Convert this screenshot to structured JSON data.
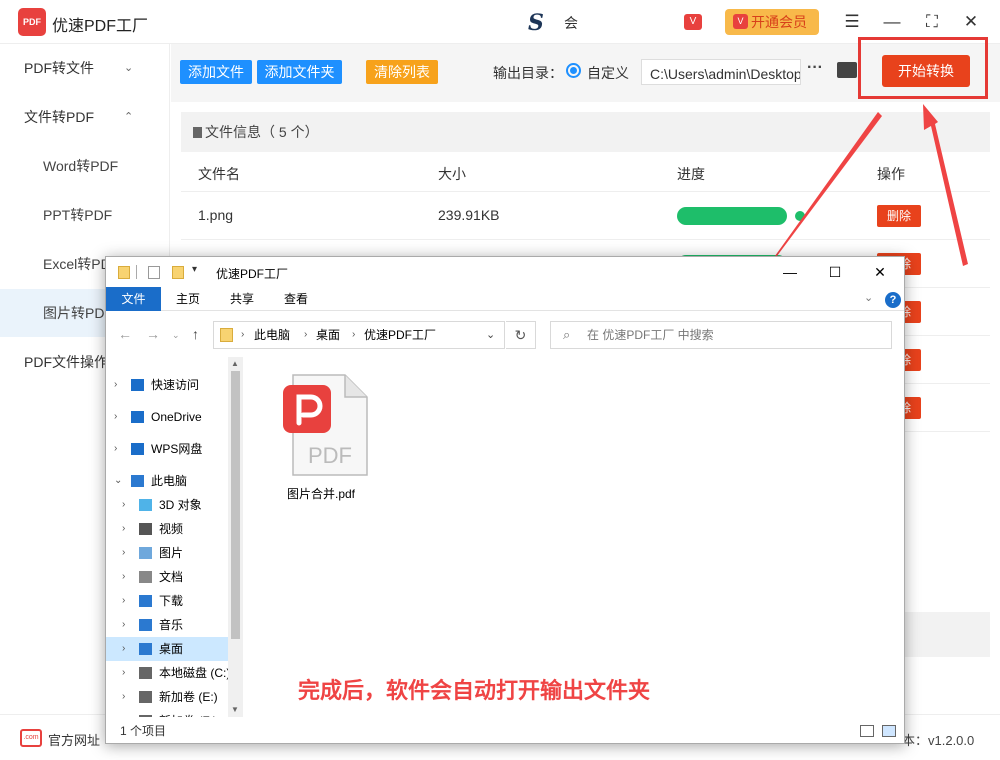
{
  "app": {
    "logo_text": "PDF",
    "title": "优速PDF工厂",
    "center_logo": "S",
    "center_text": "会",
    "vip_small": "V",
    "vip_button": "开通会员",
    "win": {
      "menu": "☰",
      "min": "—",
      "max": "⛶",
      "close": "✕"
    }
  },
  "sidebar": {
    "items": [
      {
        "label": "PDF转文件",
        "chevron": "⌄"
      },
      {
        "label": "文件转PDF",
        "chevron": "⌃"
      },
      {
        "label": "Word转PDF"
      },
      {
        "label": "PPT转PDF"
      },
      {
        "label": "Excel转PDF"
      },
      {
        "label": "图片转PDF"
      },
      {
        "label": "PDF文件操作"
      }
    ]
  },
  "toolbar": {
    "add_file": "添加文件",
    "add_folder": "添加文件夹",
    "clear_list": "清除列表",
    "output_label": "输出目录：",
    "custom_label": "自定义",
    "output_path": "C:\\Users\\admin\\Desktop\\优速PDF工厂",
    "more": "···",
    "start": "开始转换"
  },
  "table": {
    "info": "文件信息（ 5 个）",
    "headers": [
      "文件名",
      "大小",
      "进度",
      "操作"
    ],
    "rows": [
      {
        "name": "1.png",
        "size": "239.91KB",
        "progress": 1.0,
        "action": "删除"
      },
      {
        "name": "",
        "size": "",
        "progress": 1.0,
        "action": "删除"
      },
      {
        "name": "",
        "size": "",
        "progress": 1.0,
        "action": "删除"
      },
      {
        "name": "",
        "size": "",
        "progress": 1.0,
        "action": "删除"
      },
      {
        "name": "",
        "size": "",
        "progress": 1.0,
        "action": "删除"
      }
    ]
  },
  "status": {
    "site_icon": ".com",
    "site": "官方网址",
    "version": "本：v1.2.0.0"
  },
  "explorer": {
    "title": "优速PDF工厂",
    "ribbon": [
      "文件",
      "主页",
      "共享",
      "查看"
    ],
    "help": "?",
    "breadcrumb": [
      "此电脑",
      "桌面",
      "优速PDF工厂"
    ],
    "search_placeholder": "在 优速PDF工厂 中搜索",
    "nav": [
      {
        "label": "快速访问",
        "icon": "star-icon"
      },
      {
        "label": "OneDrive",
        "icon": "cloud-icon"
      },
      {
        "label": "WPS网盘",
        "icon": "cloud-icon"
      },
      {
        "label": "此电脑",
        "icon": "computer-icon"
      },
      {
        "label": "3D 对象",
        "icon": "cube-icon"
      },
      {
        "label": "视频",
        "icon": "video-icon"
      },
      {
        "label": "图片",
        "icon": "picture-icon"
      },
      {
        "label": "文档",
        "icon": "document-icon"
      },
      {
        "label": "下载",
        "icon": "download-icon"
      },
      {
        "label": "音乐",
        "icon": "music-icon"
      },
      {
        "label": "桌面",
        "icon": "desktop-icon"
      },
      {
        "label": "本地磁盘 (C:)",
        "icon": "drive-icon"
      },
      {
        "label": "新加卷 (E:)",
        "icon": "drive-icon"
      },
      {
        "label": "新加卷 (F:)",
        "icon": "drive-icon"
      }
    ],
    "file_name": "图片合并.pdf",
    "pdf_badge": "PDF",
    "annotation": "完成后，软件会自动打开输出文件夹",
    "item_count": "1 个项目"
  },
  "colors": {
    "accent": "#1e90ff",
    "danger": "#e8421c",
    "success": "#1ebe6a",
    "annotation": "#ef4444"
  }
}
